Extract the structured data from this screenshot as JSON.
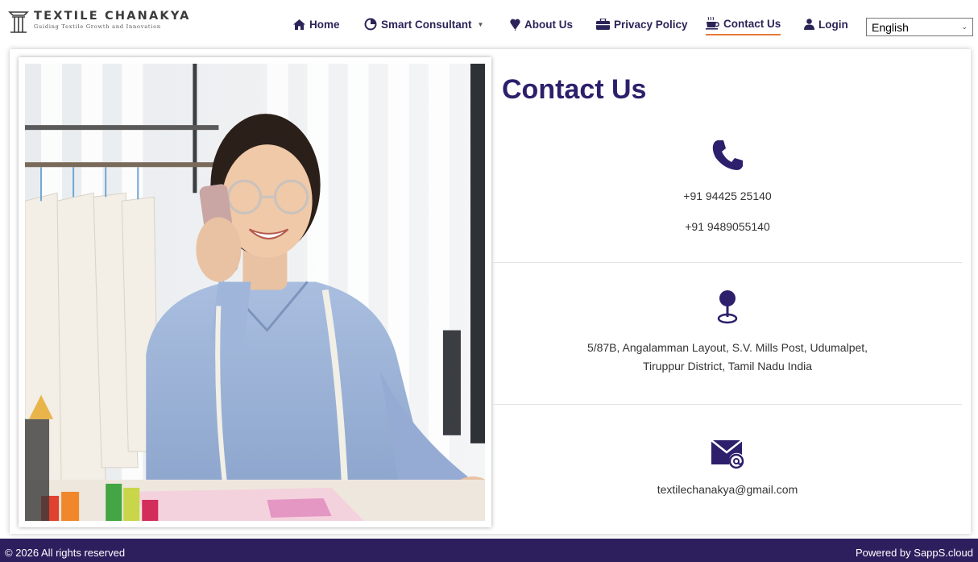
{
  "brand": {
    "name": "TEXTILE CHANAKYA",
    "tagline": "Guiding Textile Growth and Innovation"
  },
  "nav": {
    "home": "Home",
    "smart_consultant": "Smart Consultant",
    "about": "About Us",
    "privacy": "Privacy Policy",
    "contact": "Contact Us",
    "login": "Login"
  },
  "language": {
    "selected": "English"
  },
  "main": {
    "title": "Contact Us",
    "phone1": "+91 94425 25140",
    "phone2": "+91 9489055140",
    "address_line1": "5/87B, Angalamman Layout, S.V. Mills Post, Udumalpet,",
    "address_line2": "Tiruppur District, Tamil Nadu India",
    "email": "textilechanakya@gmail.com"
  },
  "footer": {
    "copyright": "© 2026 All rights reserved",
    "powered": "Powered by SappS.cloud"
  },
  "colors": {
    "accent": "#2d1f6b",
    "nav_text": "#2b2459",
    "active_underline": "#e87a3a",
    "footer_bg": "#2d1f5e"
  },
  "icons": {
    "home": "home-icon",
    "smart_consultant": "pie-chart-icon",
    "about": "heart-icon",
    "privacy": "briefcase-icon",
    "contact": "coffee-cup-icon",
    "login": "user-icon",
    "phone": "phone-icon",
    "location": "map-pin-icon",
    "email": "envelope-at-icon"
  }
}
